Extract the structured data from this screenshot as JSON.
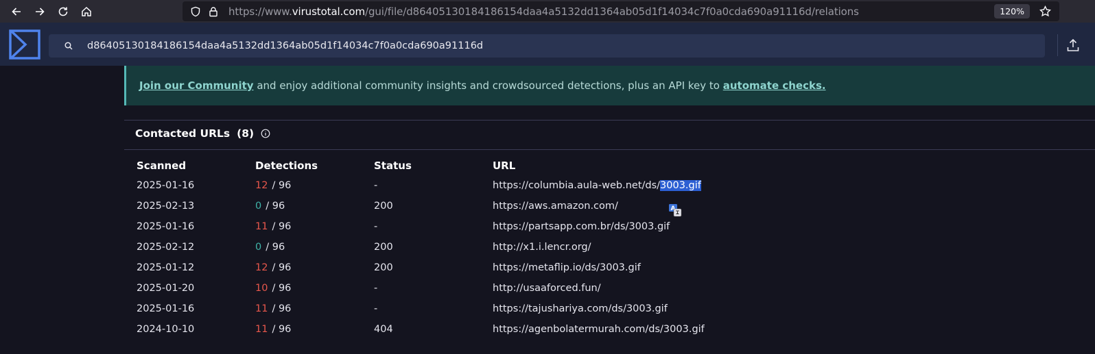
{
  "browser": {
    "url_prefix": "https://www.",
    "url_domain": "virustotal.com",
    "url_path": "/gui/file/d86405130184186154daa4a5132dd1364ab05d1f14034c7f0a0cda690a91116d/relations",
    "zoom": "120%"
  },
  "search": {
    "value": "d86405130184186154daa4a5132dd1364ab05d1f14034c7f0a0cda690a91116d"
  },
  "banner": {
    "link1": "Join our Community",
    "middle": " and enjoy additional community insights and crowdsourced detections, plus an API key to ",
    "link2": "automate checks."
  },
  "section": {
    "title": "Contacted URLs",
    "count": "(8)"
  },
  "table": {
    "headers": [
      "Scanned",
      "Detections",
      "Status",
      "URL"
    ],
    "rows": [
      {
        "scanned": "2025-01-16",
        "det": "12",
        "total": "/ 96",
        "status": "-",
        "url_main": "https://columbia.aula-web.net/ds/",
        "url_sel": "3003.gif"
      },
      {
        "scanned": "2025-02-13",
        "det": "0",
        "total": "/ 96",
        "status": "200",
        "url_main": "https://aws.amazon.com/",
        "url_sel": ""
      },
      {
        "scanned": "2025-01-16",
        "det": "11",
        "total": "/ 96",
        "status": "-",
        "url_main": "https://partsapp.com.br/ds/3003.gif",
        "url_sel": ""
      },
      {
        "scanned": "2025-02-12",
        "det": "0",
        "total": "/ 96",
        "status": "200",
        "url_main": "http://x1.i.lencr.org/",
        "url_sel": ""
      },
      {
        "scanned": "2025-01-12",
        "det": "12",
        "total": "/ 96",
        "status": "200",
        "url_main": "https://metaflip.io/ds/3003.gif",
        "url_sel": ""
      },
      {
        "scanned": "2025-01-20",
        "det": "10",
        "total": "/ 96",
        "status": "-",
        "url_main": "http://usaaforced.fun/",
        "url_sel": ""
      },
      {
        "scanned": "2025-01-16",
        "det": "11",
        "total": "/ 96",
        "status": "-",
        "url_main": "https://tajushariya.com/ds/3003.gif",
        "url_sel": ""
      },
      {
        "scanned": "2024-10-10",
        "det": "11",
        "total": "/ 96",
        "status": "404",
        "url_main": "https://agenbolatermurah.com/ds/3003.gif",
        "url_sel": ""
      }
    ]
  },
  "colors": {
    "detection_positive": "#e8574c",
    "detection_zero": "#3fb3a8",
    "banner_bg": "#173b3c",
    "header_bg": "#1f2740",
    "selection": "#2c5fd3"
  },
  "icons": [
    "back-arrow-icon",
    "forward-arrow-icon",
    "reload-icon",
    "home-icon",
    "shield-icon",
    "lock-icon",
    "star-icon",
    "virustotal-logo",
    "search-icon",
    "upload-icon",
    "info-icon",
    "translate-icon"
  ]
}
